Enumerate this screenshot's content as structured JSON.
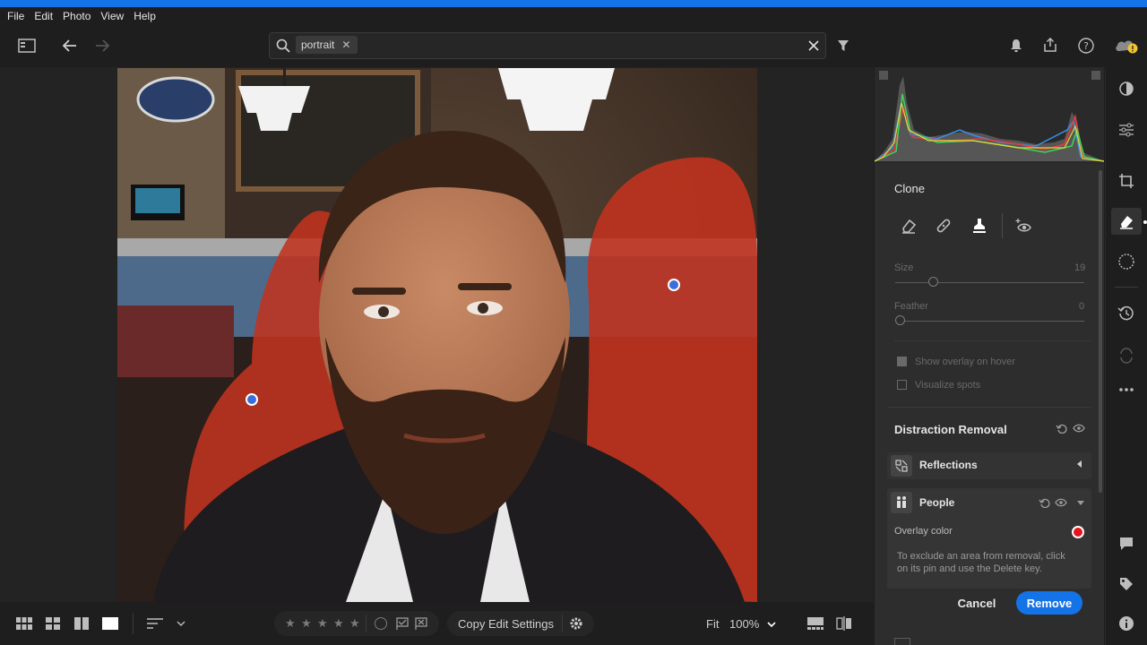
{
  "menu": [
    "File",
    "Edit",
    "Photo",
    "View",
    "Help"
  ],
  "search": {
    "chip_text": "portrait"
  },
  "icons": {
    "panel_toggle": "panel-toggle-icon",
    "back": "arrow-left-icon",
    "forward": "arrow-right-icon",
    "search": "search-icon",
    "clear": "close-icon",
    "filter": "filter-icon",
    "notifications": "bell-icon",
    "share": "share-icon",
    "help": "help-icon",
    "cloud": "cloud-warning-icon"
  },
  "panel": {
    "clone": {
      "title": "Clone",
      "size_label": "Size",
      "size_value": "19",
      "feather_label": "Feather",
      "feather_value": "0",
      "show_overlay_label": "Show overlay on hover",
      "visualize_label": "Visualize spots"
    },
    "distraction": {
      "title": "Distraction Removal",
      "reflections_label": "Reflections",
      "people_label": "People",
      "overlay_color_label": "Overlay color",
      "overlay_color": "#e8141c",
      "hint": "To exclude an area from removal, click on its pin and use the Delete key.",
      "cancel": "Cancel",
      "remove": "Remove"
    }
  },
  "bottom": {
    "copy_edit": "Copy Edit Settings",
    "fit": "Fit",
    "zoom": "100%",
    "stars": [
      "★",
      "★",
      "★",
      "★",
      "★"
    ]
  },
  "colors": {
    "accent": "#1473e6",
    "mask": "#c0331f"
  }
}
